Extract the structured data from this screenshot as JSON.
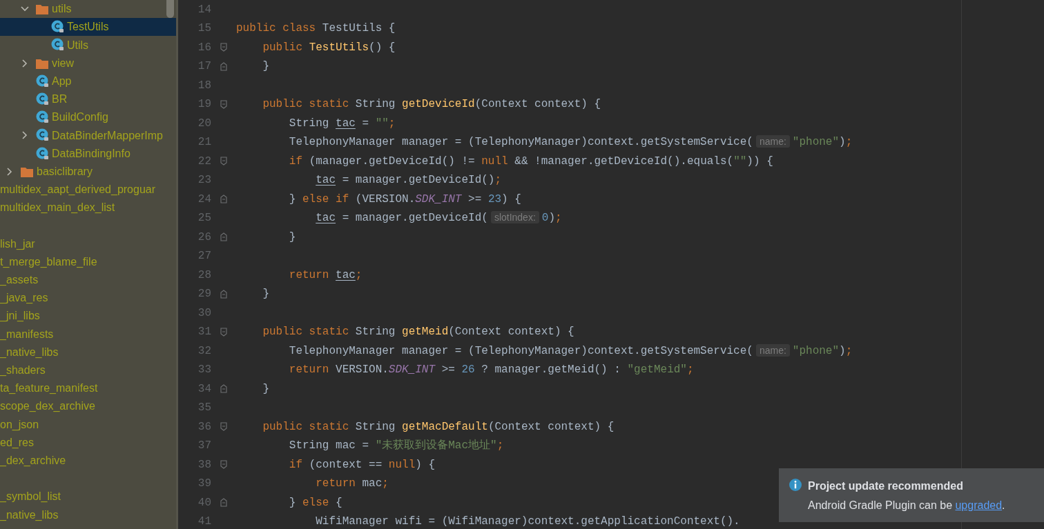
{
  "project_tree": {
    "package_items": [
      {
        "kind": "folder",
        "label": "utils",
        "expanded": true,
        "selected": false,
        "children": [
          {
            "kind": "class",
            "label": "TestUtils",
            "selected": true
          },
          {
            "kind": "class",
            "label": "Utils",
            "selected": false
          }
        ]
      },
      {
        "kind": "folder",
        "label": "view",
        "expanded": false,
        "selected": false
      },
      {
        "kind": "class",
        "label": "App",
        "selected": false
      },
      {
        "kind": "class",
        "label": "BR",
        "selected": false
      },
      {
        "kind": "class",
        "label": "BuildConfig",
        "selected": false
      },
      {
        "kind": "class",
        "label": "DataBinderMapperImp",
        "expanded": false,
        "selected": false
      },
      {
        "kind": "class",
        "label": "DataBindingInfo",
        "selected": false
      }
    ],
    "module_items": [
      {
        "kind": "folder",
        "label": "basiclibrary",
        "expanded": false,
        "selected": false
      }
    ],
    "file_groups": [
      [
        "multidex_aapt_derived_proguar",
        "multidex_main_dex_list"
      ],
      [
        "lish_jar",
        "t_merge_blame_file",
        "_assets",
        "_java_res",
        "_jni_libs",
        "_manifests",
        "_native_libs",
        "_shaders",
        "ta_feature_manifest",
        "scope_dex_archive",
        "on_json",
        "ed_res",
        "_dex_archive"
      ],
      [
        "_symbol_list",
        "_native_libs"
      ]
    ]
  },
  "editor": {
    "lines": [
      {
        "number": "14"
      },
      {
        "number": "15",
        "tokens": [
          {
            "kind": "kw",
            "text": "public class "
          },
          {
            "kind": "plain",
            "text": "TestUtils {"
          }
        ],
        "children": [
          {
            "number": "16",
            "kind": "fold-start",
            "tokens": [
              {
                "kind": "kw",
                "text": "public "
              },
              {
                "kind": "fn",
                "text": "TestUtils"
              },
              {
                "kind": "plain",
                "text": "() {"
              }
            ]
          },
          {
            "number": "17",
            "kind": "fold-end",
            "tokens": [
              {
                "kind": "plain",
                "text": "}"
              }
            ]
          },
          {
            "number": "18"
          },
          {
            "number": "19",
            "kind": "fold-start",
            "tokens": [
              {
                "kind": "kw",
                "text": "public static "
              },
              {
                "kind": "plain",
                "text": "String "
              },
              {
                "kind": "fn",
                "text": "getDeviceId"
              },
              {
                "kind": "plain",
                "text": "(Context context) {"
              }
            ],
            "children": [
              {
                "number": "20",
                "tokens": [
                  {
                    "kind": "plain",
                    "text": "String "
                  },
                  {
                    "kind": "local",
                    "text": "tac"
                  },
                  {
                    "kind": "plain",
                    "text": " = "
                  },
                  {
                    "kind": "str",
                    "text": "\"\""
                  },
                  {
                    "kind": "punct",
                    "text": ";"
                  }
                ]
              },
              {
                "number": "21",
                "tokens": [
                  {
                    "kind": "plain",
                    "text": "TelephonyManager manager = (TelephonyManager)context.getSystemService("
                  },
                  {
                    "kind": "hint",
                    "text": "name:"
                  },
                  {
                    "kind": "str",
                    "text": "\"phone\""
                  },
                  {
                    "kind": "plain",
                    "text": ")"
                  },
                  {
                    "kind": "punct",
                    "text": ";"
                  }
                ]
              },
              {
                "number": "22",
                "kind": "fold-start",
                "tokens": [
                  {
                    "kind": "kw",
                    "text": "if "
                  },
                  {
                    "kind": "plain",
                    "text": "(manager.getDeviceId() != "
                  },
                  {
                    "kind": "kw",
                    "text": "null "
                  },
                  {
                    "kind": "plain",
                    "text": "&& !manager.getDeviceId().equals("
                  },
                  {
                    "kind": "str",
                    "text": "\"\""
                  },
                  {
                    "kind": "plain",
                    "text": ")) {"
                  }
                ],
                "children": [
                  {
                    "number": "23",
                    "tokens": [
                      {
                        "kind": "local",
                        "text": "tac"
                      },
                      {
                        "kind": "plain",
                        "text": " = manager.getDeviceId()"
                      },
                      {
                        "kind": "punct",
                        "text": ";"
                      }
                    ]
                  }
                ]
              },
              {
                "number": "24",
                "kind": "fold-end",
                "tokens": [
                  {
                    "kind": "plain",
                    "text": "} "
                  },
                  {
                    "kind": "kw",
                    "text": "else if "
                  },
                  {
                    "kind": "plain",
                    "text": "(VERSION."
                  },
                  {
                    "kind": "const",
                    "text": "SDK_INT"
                  },
                  {
                    "kind": "plain",
                    "text": " >= "
                  },
                  {
                    "kind": "num",
                    "text": "23"
                  },
                  {
                    "kind": "plain",
                    "text": ") {"
                  }
                ],
                "children": [
                  {
                    "number": "25",
                    "tokens": [
                      {
                        "kind": "local",
                        "text": "tac"
                      },
                      {
                        "kind": "plain",
                        "text": " = manager.getDeviceId("
                      },
                      {
                        "kind": "hint",
                        "text": "slotIndex:"
                      },
                      {
                        "kind": "num",
                        "text": "0"
                      },
                      {
                        "kind": "plain",
                        "text": ")"
                      },
                      {
                        "kind": "punct",
                        "text": ";"
                      }
                    ]
                  }
                ]
              },
              {
                "number": "26",
                "kind": "fold-end",
                "tokens": [
                  {
                    "kind": "plain",
                    "text": "}"
                  }
                ]
              },
              {
                "number": "27"
              },
              {
                "number": "28",
                "tokens": [
                  {
                    "kind": "kw",
                    "text": "return "
                  },
                  {
                    "kind": "local",
                    "text": "tac"
                  },
                  {
                    "kind": "punct",
                    "text": ";"
                  }
                ]
              }
            ]
          },
          {
            "number": "29",
            "kind": "fold-end",
            "tokens": [
              {
                "kind": "plain",
                "text": "}"
              }
            ]
          },
          {
            "number": "30"
          },
          {
            "number": "31",
            "kind": "fold-start",
            "tokens": [
              {
                "kind": "kw",
                "text": "public static "
              },
              {
                "kind": "plain",
                "text": "String "
              },
              {
                "kind": "fn",
                "text": "getMeid"
              },
              {
                "kind": "plain",
                "text": "(Context context) {"
              }
            ],
            "children": [
              {
                "number": "32",
                "tokens": [
                  {
                    "kind": "plain",
                    "text": "TelephonyManager manager = (TelephonyManager)context.getSystemService("
                  },
                  {
                    "kind": "hint",
                    "text": "name:"
                  },
                  {
                    "kind": "str",
                    "text": "\"phone\""
                  },
                  {
                    "kind": "plain",
                    "text": ")"
                  },
                  {
                    "kind": "punct",
                    "text": ";"
                  }
                ]
              },
              {
                "number": "33",
                "tokens": [
                  {
                    "kind": "kw",
                    "text": "return "
                  },
                  {
                    "kind": "plain",
                    "text": "VERSION."
                  },
                  {
                    "kind": "const",
                    "text": "SDK_INT"
                  },
                  {
                    "kind": "plain",
                    "text": " >= "
                  },
                  {
                    "kind": "num",
                    "text": "26"
                  },
                  {
                    "kind": "plain",
                    "text": " ? manager.getMeid() : "
                  },
                  {
                    "kind": "str",
                    "text": "\"getMeid\""
                  },
                  {
                    "kind": "punct",
                    "text": ";"
                  }
                ]
              }
            ]
          },
          {
            "number": "34",
            "kind": "fold-end",
            "tokens": [
              {
                "kind": "plain",
                "text": "}"
              }
            ]
          },
          {
            "number": "35"
          },
          {
            "number": "36",
            "kind": "fold-start",
            "tokens": [
              {
                "kind": "kw",
                "text": "public static "
              },
              {
                "kind": "plain",
                "text": "String "
              },
              {
                "kind": "fn",
                "text": "getMacDefault"
              },
              {
                "kind": "plain",
                "text": "(Context context) {"
              }
            ],
            "children": [
              {
                "number": "37",
                "tokens": [
                  {
                    "kind": "plain",
                    "text": "String mac = "
                  },
                  {
                    "kind": "str",
                    "text": "\"未获取到设备Mac地址\""
                  },
                  {
                    "kind": "punct",
                    "text": ";"
                  }
                ]
              },
              {
                "number": "38",
                "kind": "fold-start",
                "tokens": [
                  {
                    "kind": "kw",
                    "text": "if "
                  },
                  {
                    "kind": "plain",
                    "text": "(context == "
                  },
                  {
                    "kind": "kw",
                    "text": "null"
                  },
                  {
                    "kind": "plain",
                    "text": ") {"
                  }
                ],
                "children": [
                  {
                    "number": "39",
                    "tokens": [
                      {
                        "kind": "kw",
                        "text": "return "
                      },
                      {
                        "kind": "plain",
                        "text": "mac"
                      },
                      {
                        "kind": "punct",
                        "text": ";"
                      }
                    ]
                  }
                ]
              },
              {
                "number": "40",
                "kind": "fold-end",
                "tokens": [
                  {
                    "kind": "plain",
                    "text": "} "
                  },
                  {
                    "kind": "kw",
                    "text": "else "
                  },
                  {
                    "kind": "plain",
                    "text": "{"
                  }
                ],
                "children": [
                  {
                    "number": "41",
                    "tokens": [
                      {
                        "kind": "plain",
                        "text": "WifiManager wifi = (WifiManager)context.getApplicationContext()."
                      }
                    ]
                  }
                ]
              }
            ]
          }
        ]
      }
    ]
  },
  "notification": {
    "title": "Project update recommended",
    "text": "Android Gradle Plugin can be ",
    "link": "upgraded",
    "text_end": "."
  }
}
